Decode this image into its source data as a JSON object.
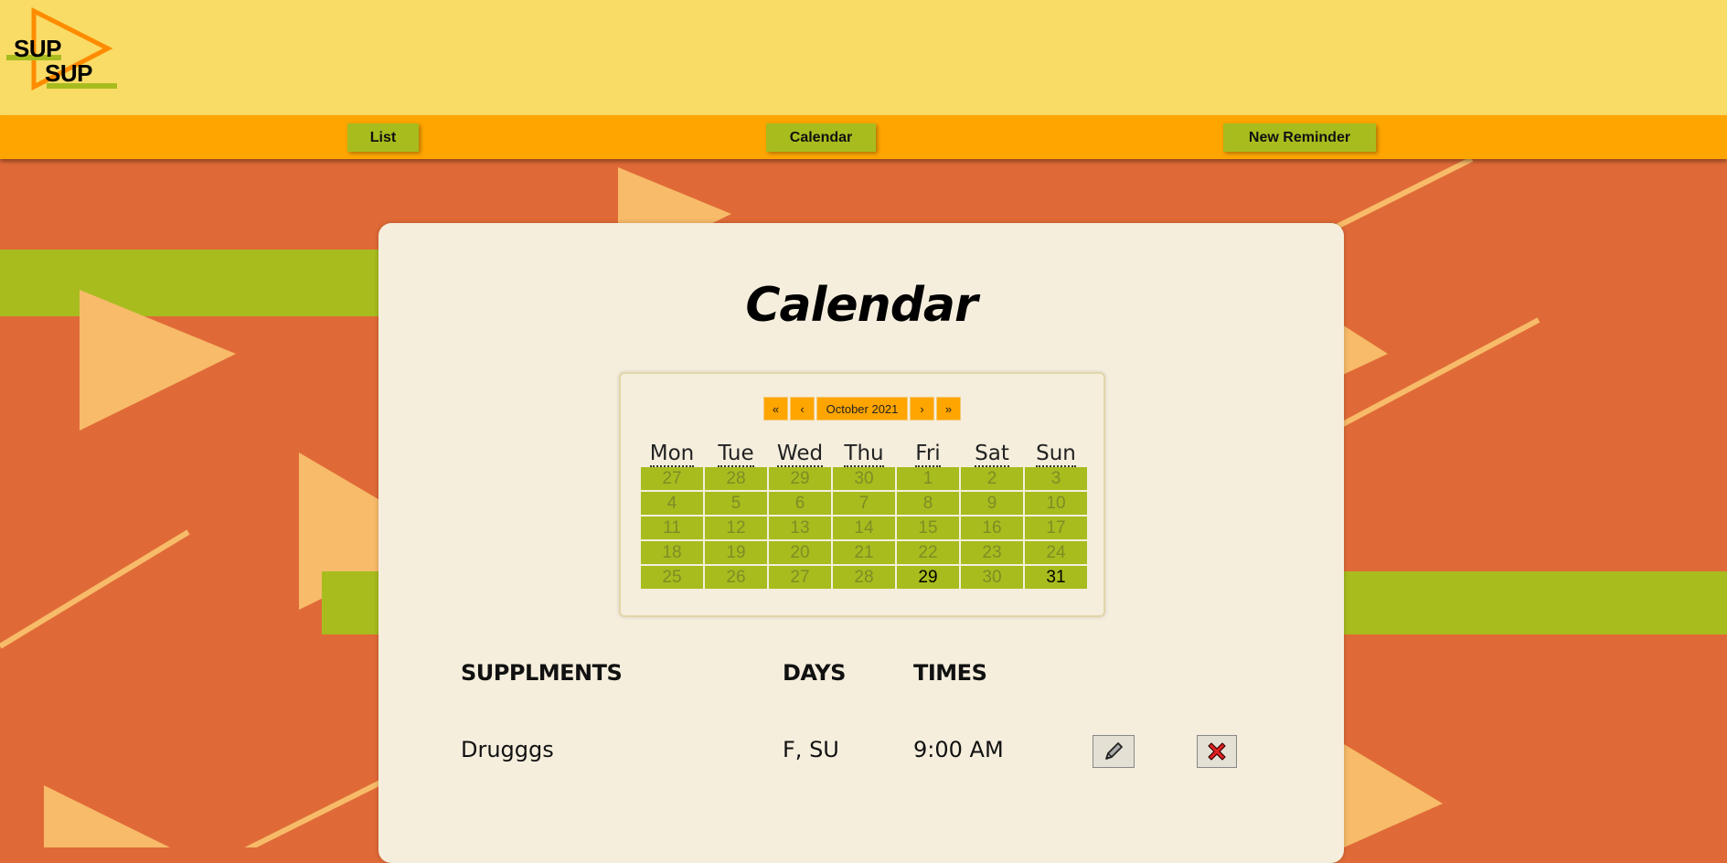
{
  "app": {
    "logo": {
      "line1": "SUP",
      "line2": "SUP"
    }
  },
  "nav": {
    "list": "List",
    "calendar": "Calendar",
    "new_reminder": "New Reminder"
  },
  "main": {
    "title": "Calendar"
  },
  "calendar": {
    "first": "«",
    "prev": "‹",
    "month_label": "October 2021",
    "next": "›",
    "last": "»",
    "weekdays": [
      "Mon",
      "Tue",
      "Wed",
      "Thu",
      "Fri",
      "Sat",
      "Sun"
    ],
    "weeks": [
      [
        {
          "d": "27",
          "a": false
        },
        {
          "d": "28",
          "a": false
        },
        {
          "d": "29",
          "a": false
        },
        {
          "d": "30",
          "a": false
        },
        {
          "d": "1",
          "a": false
        },
        {
          "d": "2",
          "a": false
        },
        {
          "d": "3",
          "a": false
        }
      ],
      [
        {
          "d": "4",
          "a": false
        },
        {
          "d": "5",
          "a": false
        },
        {
          "d": "6",
          "a": false
        },
        {
          "d": "7",
          "a": false
        },
        {
          "d": "8",
          "a": false
        },
        {
          "d": "9",
          "a": false
        },
        {
          "d": "10",
          "a": false
        }
      ],
      [
        {
          "d": "11",
          "a": false
        },
        {
          "d": "12",
          "a": false
        },
        {
          "d": "13",
          "a": false
        },
        {
          "d": "14",
          "a": false
        },
        {
          "d": "15",
          "a": false
        },
        {
          "d": "16",
          "a": false
        },
        {
          "d": "17",
          "a": false
        }
      ],
      [
        {
          "d": "18",
          "a": false
        },
        {
          "d": "19",
          "a": false
        },
        {
          "d": "20",
          "a": false
        },
        {
          "d": "21",
          "a": false
        },
        {
          "d": "22",
          "a": false
        },
        {
          "d": "23",
          "a": false
        },
        {
          "d": "24",
          "a": false
        }
      ],
      [
        {
          "d": "25",
          "a": false
        },
        {
          "d": "26",
          "a": false
        },
        {
          "d": "27",
          "a": false
        },
        {
          "d": "28",
          "a": false
        },
        {
          "d": "29",
          "a": true
        },
        {
          "d": "30",
          "a": false
        },
        {
          "d": "31",
          "a": true
        }
      ]
    ]
  },
  "table": {
    "headers": {
      "supplements": "SUPPLMENTS",
      "days": "DAYS",
      "times": "TIMES"
    },
    "rows": [
      {
        "name": "Drugggs",
        "days": "F, SU",
        "time": "9:00 AM",
        "edit_icon": "pencil-icon",
        "delete_icon": "close-icon"
      }
    ]
  },
  "colors": {
    "header_bg": "#f8dc66",
    "nav_bg": "#ffa500",
    "accent_green": "#a8bc1e",
    "page_bg": "#e06a37",
    "panel_bg": "#f5eedd"
  }
}
